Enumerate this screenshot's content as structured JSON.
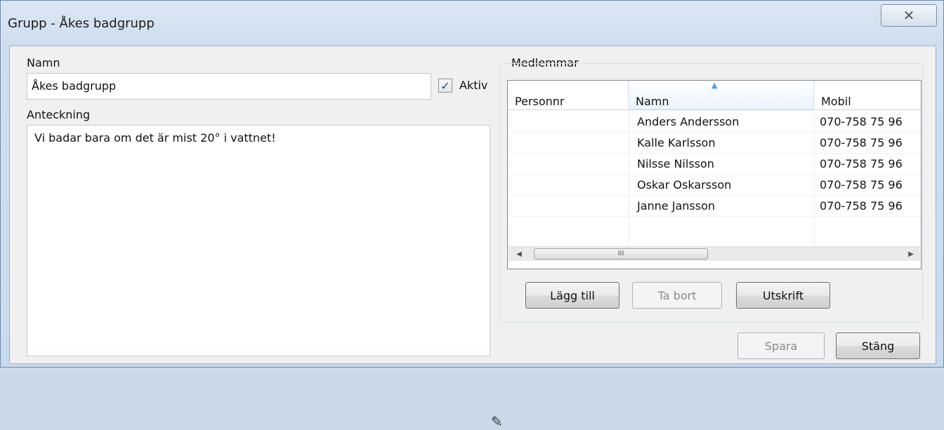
{
  "window": {
    "title": "Grupp - Åkes badgrupp",
    "close_glyph": "✕"
  },
  "form": {
    "name_label": "Namn",
    "name_value": "Åkes badgrupp",
    "active_label": "Aktiv",
    "active_checked": true,
    "note_label": "Anteckning",
    "note_value": "Vi badar bara om det är mist 20° i vattnet!"
  },
  "members": {
    "group_label": "Medlemmar",
    "columns": [
      "Personnr",
      "Namn",
      "Mobil"
    ],
    "sorted_column": "Namn",
    "rows": [
      {
        "personnr": "",
        "namn": "Anders Andersson",
        "mobil": "070-758 75 96"
      },
      {
        "personnr": "",
        "namn": "Kalle Karlsson",
        "mobil": "070-758 75 96"
      },
      {
        "personnr": "",
        "namn": "Nilsse Nilsson",
        "mobil": "070-758 75 96"
      },
      {
        "personnr": "",
        "namn": "Oskar Oskarsson",
        "mobil": "070-758 75 96"
      },
      {
        "personnr": "",
        "namn": "Janne Jansson",
        "mobil": "070-758 75 96"
      }
    ],
    "scroll_thumb_glyph": "III",
    "buttons": {
      "add": "Lägg till",
      "remove": "Ta bort",
      "print": "Utskrift"
    }
  },
  "footer": {
    "save": "Spara",
    "close": "Stäng"
  },
  "icons": {
    "close": "close-icon",
    "check": "check-icon",
    "sort": "sort-up-icon",
    "resize": "resize-grip-icon"
  }
}
